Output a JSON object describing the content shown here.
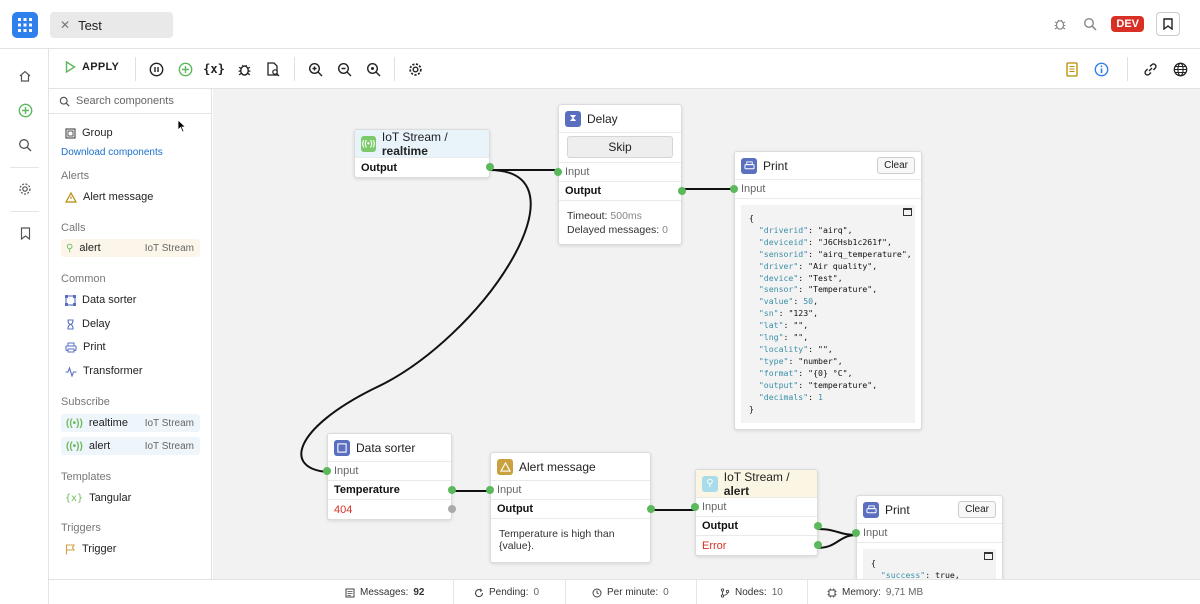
{
  "tab": {
    "title": "Test"
  },
  "header": {
    "env_badge": "DEV"
  },
  "toolbar": {
    "apply_label": "APPLY"
  },
  "sidebar": {
    "search_placeholder": "Search components",
    "group_item": "Group",
    "download_link": "Download components",
    "sections": {
      "alerts": "Alerts",
      "calls": "Calls",
      "common": "Common",
      "subscribe": "Subscribe",
      "templates": "Templates",
      "triggers": "Triggers"
    },
    "items": {
      "alert_message": "Alert message",
      "call_alert": "alert",
      "call_alert_tag": "IoT Stream",
      "data_sorter": "Data sorter",
      "delay": "Delay",
      "print": "Print",
      "transformer": "Transformer",
      "sub_realtime": "realtime",
      "sub_realtime_tag": "IoT Stream",
      "sub_alert": "alert",
      "sub_alert_tag": "IoT Stream",
      "tangular": "Tangular",
      "trigger": "Trigger"
    }
  },
  "nodes": {
    "iot_realtime": {
      "prefix": "IoT Stream / ",
      "name": "realtime",
      "output": "Output"
    },
    "delay": {
      "title": "Delay",
      "skip": "Skip",
      "input": "Input",
      "output": "Output",
      "timeout_label": "Timeout:",
      "timeout_value": "500ms",
      "delayed_label": "Delayed messages:",
      "delayed_value": "0"
    },
    "print1": {
      "title": "Print",
      "clear": "Clear",
      "input": "Input"
    },
    "data_sorter": {
      "title": "Data sorter",
      "input": "Input",
      "output": "Temperature",
      "error": "404"
    },
    "alert_message": {
      "title": "Alert message",
      "input": "Input",
      "output": "Output",
      "text": "Temperature is high than {value}."
    },
    "iot_alert": {
      "prefix": "IoT Stream / ",
      "name": "alert",
      "input": "Input",
      "output": "Output",
      "error": "Error"
    },
    "print2": {
      "title": "Print",
      "clear": "Clear",
      "input": "Input"
    }
  },
  "json_preview_1": [
    [
      "\"driverid\"",
      "\"airq\"",
      "s"
    ],
    [
      "\"deviceid\"",
      "\"J6CHsb1c261f\"",
      "s"
    ],
    [
      "\"sensorid\"",
      "\"airq_temperature\"",
      "s"
    ],
    [
      "\"driver\"",
      "\"Air quality\"",
      "s"
    ],
    [
      "\"device\"",
      "\"Test\"",
      "s"
    ],
    [
      "\"sensor\"",
      "\"Temperature\"",
      "s"
    ],
    [
      "\"value\"",
      "50",
      "n"
    ],
    [
      "\"sn\"",
      "\"123\"",
      "s"
    ],
    [
      "\"lat\"",
      "\"\"",
      "s"
    ],
    [
      "\"lng\"",
      "\"\"",
      "s"
    ],
    [
      "\"locality\"",
      "\"\"",
      "s"
    ],
    [
      "\"type\"",
      "\"number\"",
      "s"
    ],
    [
      "\"format\"",
      "\"{0} °C\"",
      "s"
    ],
    [
      "\"output\"",
      "\"temperature\"",
      "s"
    ],
    [
      "\"decimals\"",
      "1",
      "n"
    ]
  ],
  "json_preview_2": {
    "key": "\"success\"",
    "value": "true"
  },
  "status": {
    "messages_label": "Messages:",
    "messages_value": "92",
    "pending_label": "Pending:",
    "pending_value": "0",
    "per_minute_label": "Per minute:",
    "per_minute_value": "0",
    "nodes_label": "Nodes:",
    "nodes_value": "10",
    "memory_label": "Memory:",
    "memory_value": "9,71 MB"
  },
  "colors": {
    "accent": "#2f80ed",
    "green": "#5cb85c",
    "danger": "#d93025"
  }
}
